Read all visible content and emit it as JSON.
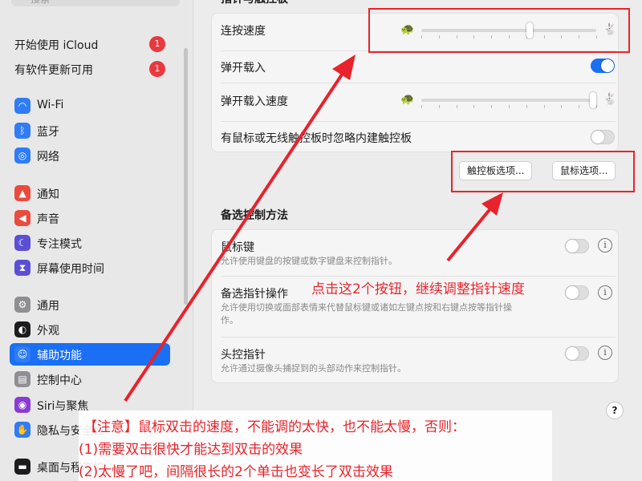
{
  "sidebar": {
    "search_placeholder": "搜索",
    "updates": [
      {
        "label": "开始使用 iCloud",
        "badge": "1"
      },
      {
        "label": "有软件更新可用",
        "badge": "1"
      }
    ],
    "items": [
      {
        "label": "Wi-Fi",
        "icon": "wifi-icon",
        "glyph": "◠",
        "color": "#2f7cf6"
      },
      {
        "label": "蓝牙",
        "icon": "bluetooth-icon",
        "glyph": "ᛒ",
        "color": "#2f7cf6"
      },
      {
        "label": "网络",
        "icon": "globe-icon",
        "glyph": "◎",
        "color": "#2f7cf6"
      },
      {
        "label": "通知",
        "icon": "bell-icon",
        "glyph": "▲",
        "color": "#ea4b3c"
      },
      {
        "label": "声音",
        "icon": "speaker-icon",
        "glyph": "◀",
        "color": "#ea4b3c"
      },
      {
        "label": "专注模式",
        "icon": "moon-icon",
        "glyph": "☾",
        "color": "#5b4fd6"
      },
      {
        "label": "屏幕使用时间",
        "icon": "hourglass-icon",
        "glyph": "⧗",
        "color": "#5b4fd6"
      },
      {
        "label": "通用",
        "icon": "gear-icon",
        "glyph": "⚙",
        "color": "#8e8e93"
      },
      {
        "label": "外观",
        "icon": "appearance-icon",
        "glyph": "◐",
        "color": "#1c1c1e"
      },
      {
        "label": "辅助功能",
        "icon": "accessibility-icon",
        "glyph": "☺",
        "color": "#2f7cf6"
      },
      {
        "label": "控制中心",
        "icon": "control-center-icon",
        "glyph": "▤",
        "color": "#8e8e93"
      },
      {
        "label": "Siri与聚焦",
        "icon": "siri-icon",
        "glyph": "◉",
        "color": "#8a3bd6"
      },
      {
        "label": "隐私与安全性",
        "icon": "hand-icon",
        "glyph": "✋",
        "color": "#2f7cf6"
      },
      {
        "label": "桌面与程序坞",
        "icon": "dock-icon",
        "glyph": "▬",
        "color": "#1c1c1e"
      }
    ],
    "active_index": 9
  },
  "main": {
    "section1_title": "指针与触控板",
    "double_click_speed_label": "连按速度",
    "double_click_speed_value": 0.62,
    "spring_loading_label": "弹开载入",
    "spring_loading_on": true,
    "spring_loading_speed_label": "弹开载入速度",
    "spring_loading_speed_value": 0.98,
    "ignore_trackpad_label": "有鼠标或无线触控板时忽略内建触控板",
    "ignore_trackpad_on": false,
    "trackpad_options_button": "触控板选项...",
    "mouse_options_button": "鼠标选项...",
    "section2_title": "备选控制方法",
    "mouse_keys_label": "鼠标键",
    "mouse_keys_desc": "允许使用键盘的按键或数字键盘来控制指针。",
    "alt_pointer_label": "备选指针操作",
    "alt_pointer_desc": "允许使用切换或面部表情来代替鼠标键或诸如左键点按和右键点按等指针操作。",
    "head_pointer_label": "头控指针",
    "head_pointer_desc": "允许通过摄像头捕捉到的头部动作来控制指针。",
    "help_label": "?"
  },
  "annotations": {
    "buttons_note": "点击这2个按钮，继续调整指针速度",
    "note_line1": "【注意】鼠标双击的速度，不能调的太快，也不能太慢，否则：",
    "note_line2": "(1)需要双击很快才能达到双击的效果",
    "note_line3": "(2)太慢了吧，间隔很长的2个单击也变长了双击效果",
    "color": "#e8232b"
  }
}
